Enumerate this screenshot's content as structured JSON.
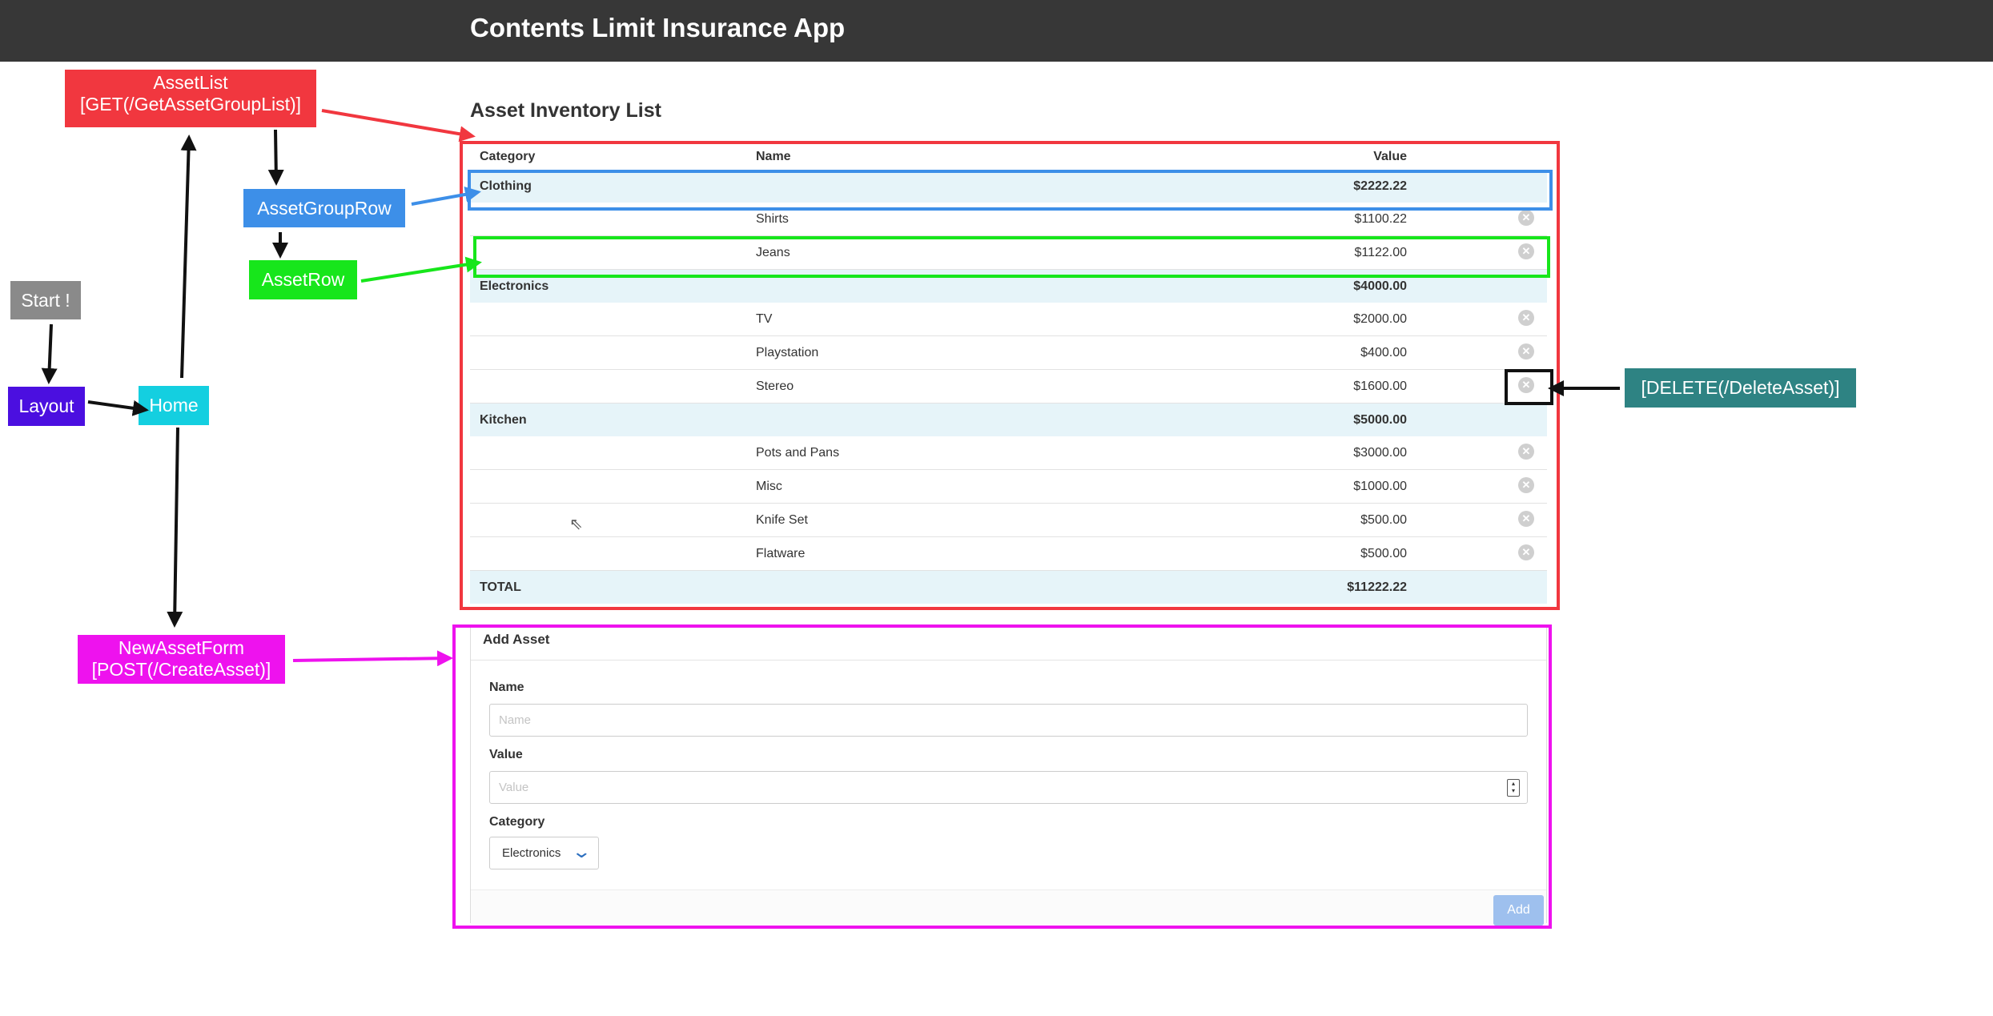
{
  "app_title": "Contents Limit Insurance App",
  "section_title": "Asset Inventory List",
  "table": {
    "headers": {
      "category": "Category",
      "name": "Name",
      "value": "Value"
    },
    "groups": [
      {
        "category": "Clothing",
        "total": "$2222.22",
        "items": [
          {
            "name": "Shirts",
            "value": "$1100.22"
          },
          {
            "name": "Jeans",
            "value": "$1122.00"
          }
        ]
      },
      {
        "category": "Electronics",
        "total": "$4000.00",
        "items": [
          {
            "name": "TV",
            "value": "$2000.00"
          },
          {
            "name": "Playstation",
            "value": "$400.00"
          },
          {
            "name": "Stereo",
            "value": "$1600.00"
          }
        ]
      },
      {
        "category": "Kitchen",
        "total": "$5000.00",
        "items": [
          {
            "name": "Pots and Pans",
            "value": "$3000.00"
          },
          {
            "name": "Misc",
            "value": "$1000.00"
          },
          {
            "name": "Knife Set",
            "value": "$500.00"
          },
          {
            "name": "Flatware",
            "value": "$500.00"
          }
        ]
      }
    ],
    "total_label": "TOTAL",
    "total_value": "$11222.22",
    "delete_glyph": "✕"
  },
  "form": {
    "title": "Add Asset",
    "name_label": "Name",
    "name_placeholder": "Name",
    "value_label": "Value",
    "value_placeholder": "Value",
    "category_label": "Category",
    "category_selected": "Electronics",
    "category_options": [
      "Electronics"
    ],
    "add_label": "Add"
  },
  "annotations": {
    "start": "Start !",
    "layout": "Layout",
    "home": "Home",
    "asset_list": [
      "AssetList",
      "[GET(/GetAssetGroupList)]"
    ],
    "asset_group_row": "AssetGroupRow",
    "asset_row": "AssetRow",
    "new_asset_form": [
      "NewAssetForm",
      "[POST(/CreateAsset)]"
    ],
    "delete_asset": "[DELETE(/DeleteAsset)]"
  },
  "colors": {
    "header_bg": "#373737",
    "row_highlight": "#e6f4f9",
    "asset_list": "#f1373f",
    "asset_group_row": "#3d8fe8",
    "asset_row": "#17e61b",
    "new_asset_form": "#ee12ee",
    "start": "#8a8a8a",
    "layout": "#4b0fe0",
    "home": "#14cfe0",
    "delete_asset": "#2e8383",
    "add_button": "#9ec0ee"
  },
  "icons": {
    "delete": "close-circle-icon",
    "dropdown": "chevron-down-icon",
    "spinner": "number-spinner-icon",
    "cursor": "mouse-pointer-icon"
  }
}
